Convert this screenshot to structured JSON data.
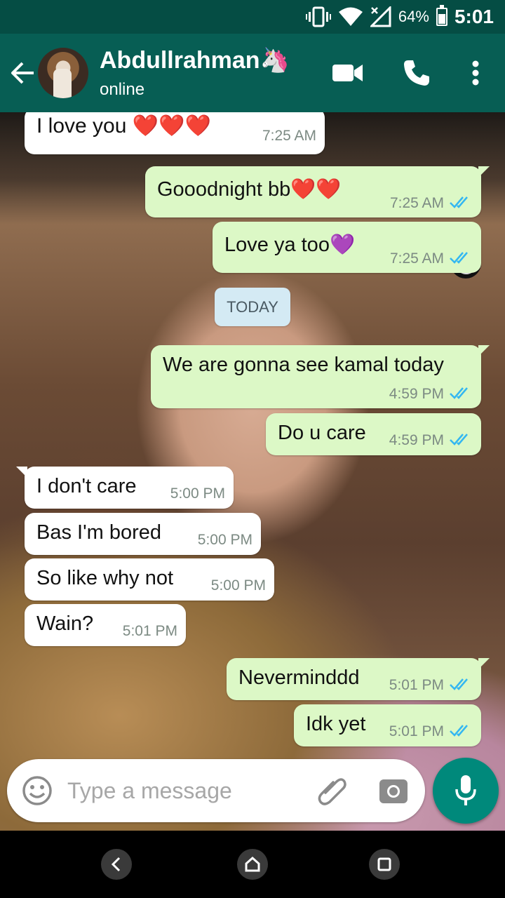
{
  "status_bar": {
    "battery": "64%",
    "time": "5:01",
    "icons": [
      "vibrate-icon",
      "wifi-icon",
      "signal-icon",
      "battery-icon"
    ]
  },
  "header": {
    "name": "Abdullrahman",
    "name_emoji": "🦄",
    "status": "online"
  },
  "date_divider": "TODAY",
  "messages": [
    {
      "dir": "in",
      "text": "I love you ❤️❤️❤️",
      "time": "7:25 AM"
    },
    {
      "dir": "out",
      "text": "Gooodnight bb❤️❤️",
      "time": "7:25 AM",
      "read": true
    },
    {
      "dir": "out",
      "text": "Love ya too💜",
      "time": "7:25 AM",
      "read": true
    },
    {
      "dir": "out",
      "text": "We are gonna see kamal today",
      "time": "4:59 PM",
      "read": true
    },
    {
      "dir": "out",
      "text": "Do u care",
      "time": "4:59 PM",
      "read": true
    },
    {
      "dir": "in",
      "text": "I don't care",
      "time": "5:00 PM"
    },
    {
      "dir": "in",
      "text": "Bas I'm bored",
      "time": "5:00 PM"
    },
    {
      "dir": "in",
      "text": "So like why not",
      "time": "5:00 PM"
    },
    {
      "dir": "in",
      "text": "Wain?",
      "time": "5:01 PM"
    },
    {
      "dir": "out",
      "text": "Neverminddd",
      "time": "5:01 PM",
      "read": true
    },
    {
      "dir": "out",
      "text": "Idk yet",
      "time": "5:01 PM",
      "read": true
    }
  ],
  "composer": {
    "placeholder": "Type a message"
  },
  "colors": {
    "header": "#075e54",
    "status_bar": "#054d44",
    "outgoing_bubble": "#dcf8c6",
    "incoming_bubble": "#ffffff",
    "mic_button": "#00897b",
    "read_ticks": "#34b7f1"
  }
}
